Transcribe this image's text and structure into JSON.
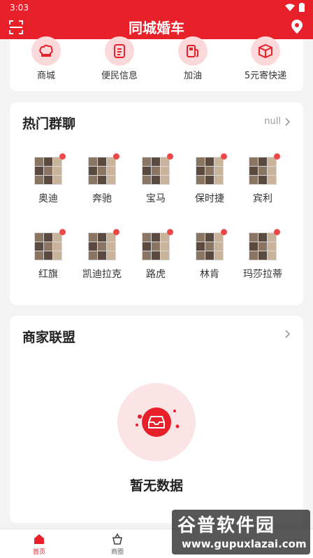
{
  "status": {
    "time": "3:03"
  },
  "appbar": {
    "title": "同城婚车"
  },
  "quick_links": [
    {
      "label": "商城",
      "icon": "chef-hat-icon"
    },
    {
      "label": "便民信息",
      "icon": "notes-icon"
    },
    {
      "label": "加油",
      "icon": "fuel-icon"
    },
    {
      "label": "5元寄快递",
      "icon": "package-icon"
    }
  ],
  "hot_groups": {
    "title": "热门群聊",
    "more": "null",
    "groups": [
      {
        "name": "奥迪"
      },
      {
        "name": "奔驰"
      },
      {
        "name": "宝马"
      },
      {
        "name": "保时捷"
      },
      {
        "name": "宾利"
      },
      {
        "name": "红旗"
      },
      {
        "name": "凯迪拉克"
      },
      {
        "name": "路虎"
      },
      {
        "name": "林肯"
      },
      {
        "name": "玛莎拉蒂"
      }
    ]
  },
  "merchants": {
    "title": "商家联盟",
    "empty_text": "暂无数据"
  },
  "tabbar": {
    "tabs": [
      {
        "label": "首页",
        "active": true
      },
      {
        "label": "商圈",
        "active": false
      }
    ]
  },
  "watermark": {
    "title": "谷普软件园",
    "url": "www.gupuxlazai.com"
  },
  "colors": {
    "brand": "#e8202a",
    "badge": "#f04848"
  }
}
